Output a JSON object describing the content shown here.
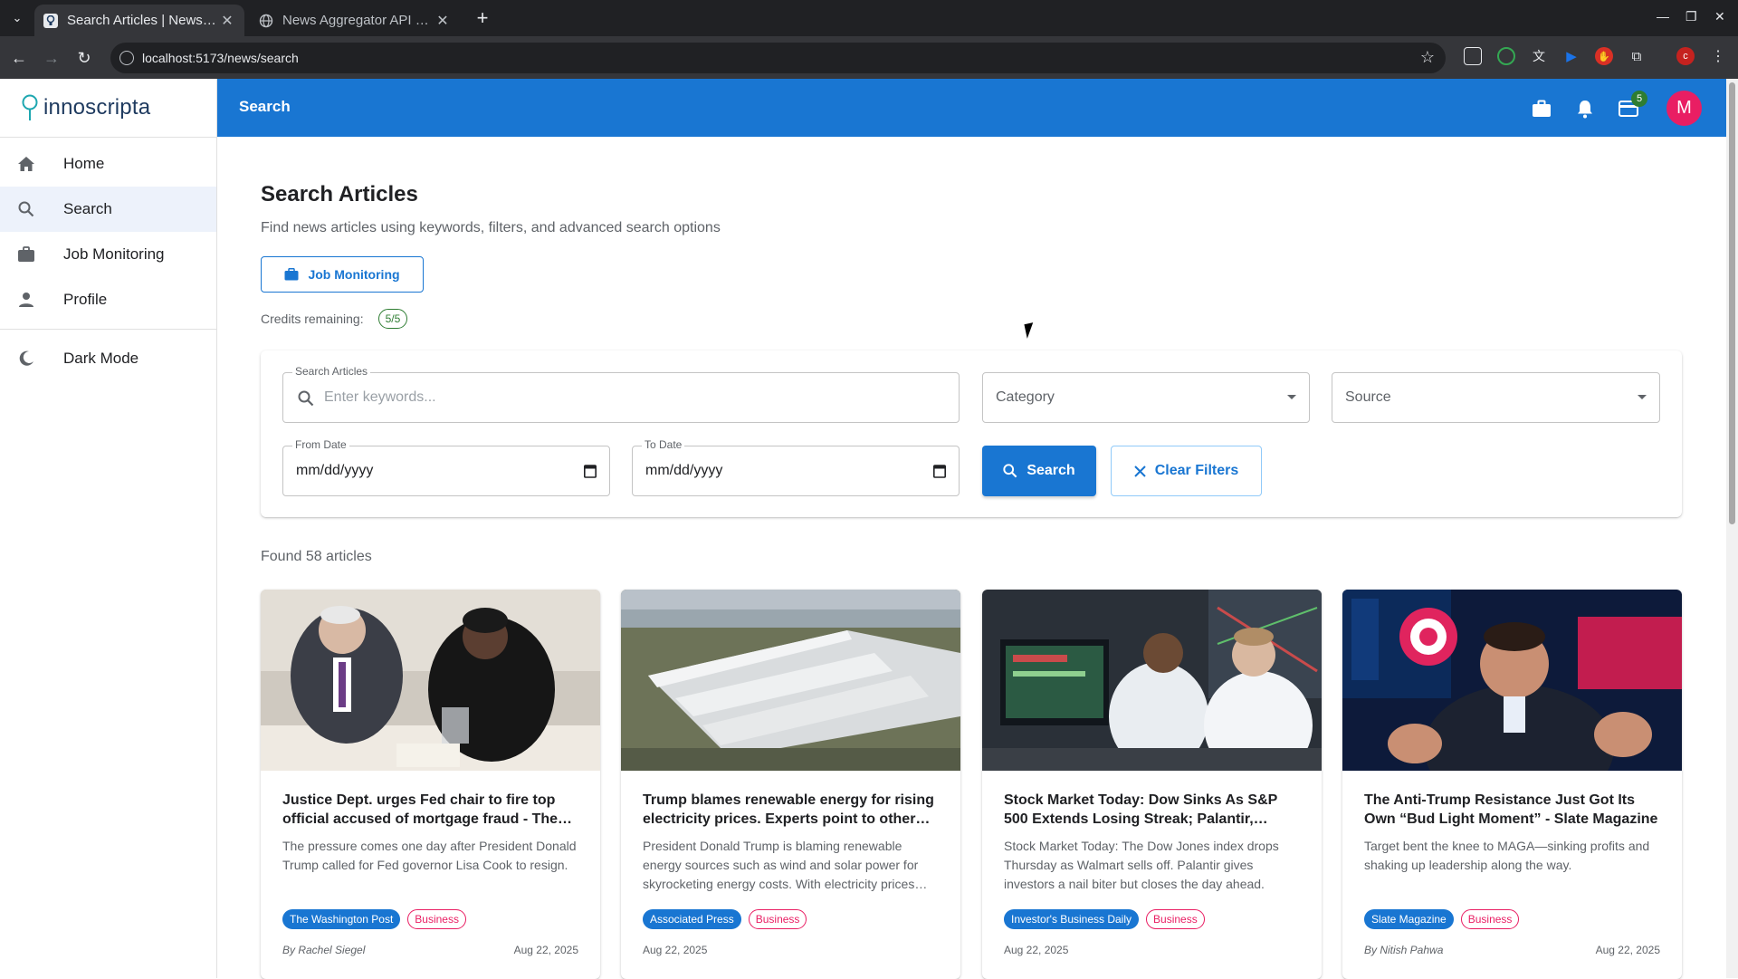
{
  "browser": {
    "tabs": [
      {
        "title": "Search Articles | News Aggregator",
        "active": true
      },
      {
        "title": "News Aggregator API Docs",
        "active": false
      }
    ],
    "url": "localhost:5173/news/search"
  },
  "app": {
    "logo_text": "innoscripta",
    "sidebar": {
      "items": [
        {
          "label": "Home",
          "icon": "home-icon"
        },
        {
          "label": "Search",
          "icon": "search-icon",
          "selected": true
        },
        {
          "label": "Job Monitoring",
          "icon": "briefcase-icon"
        },
        {
          "label": "Profile",
          "icon": "person-icon"
        }
      ],
      "dark_mode_label": "Dark Mode"
    },
    "topbar": {
      "title": "Search",
      "cart_badge": "5",
      "avatar_initial": "M"
    }
  },
  "page": {
    "title": "Search Articles",
    "subtitle": "Find news articles using keywords, filters, and advanced search options",
    "job_monitoring_button": "Job Monitoring",
    "credits_label": "Credits remaining:",
    "credits_value": "5/5",
    "filters": {
      "search_label": "Search Articles",
      "search_placeholder": "Enter keywords...",
      "category_placeholder": "Category",
      "source_placeholder": "Source",
      "from_date_label": "From Date",
      "from_date_value": "mm/dd/yyyy",
      "to_date_label": "To Date",
      "to_date_value": "mm/dd/yyyy",
      "search_button": "Search",
      "clear_button": "Clear Filters"
    },
    "found_text": "Found 58 articles",
    "articles": [
      {
        "title": "Justice Dept. urges Fed chair to fire top official accused of mortgage fraud - The Washington Post",
        "description": "The pressure comes one day after President Donald Trump called for Fed governor Lisa Cook to resign.",
        "source": "The Washington Post",
        "category": "Business",
        "author": "By Rachel Siegel",
        "date": "Aug 22, 2025"
      },
      {
        "title": "Trump blames renewable energy for rising electricity prices. Experts point to other factors",
        "description": "President Donald Trump is blaming renewable energy sources such as wind and solar power for skyrocketing energy costs. With electricity prices rising",
        "source": "Associated Press",
        "category": "Business",
        "author": "",
        "date": "Aug 22, 2025"
      },
      {
        "title": "Stock Market Today: Dow Sinks As S&P 500 Extends Losing Streak; Palantir, Walmart Slide",
        "description": "Stock Market Today: The Dow Jones index drops Thursday as Walmart sells off. Palantir gives investors a nail biter but closes the day ahead.",
        "source": "Investor's Business Daily",
        "category": "Business",
        "author": "",
        "date": "Aug 22, 2025"
      },
      {
        "title": "The Anti-Trump Resistance Just Got Its Own “Bud Light Moment” - Slate Magazine",
        "description": "Target bent the knee to MAGA—sinking profits and shaking up leadership along the way.",
        "source": "Slate Magazine",
        "category": "Business",
        "author": "By Nitish Pahwa",
        "date": "Aug 22, 2025"
      }
    ]
  }
}
